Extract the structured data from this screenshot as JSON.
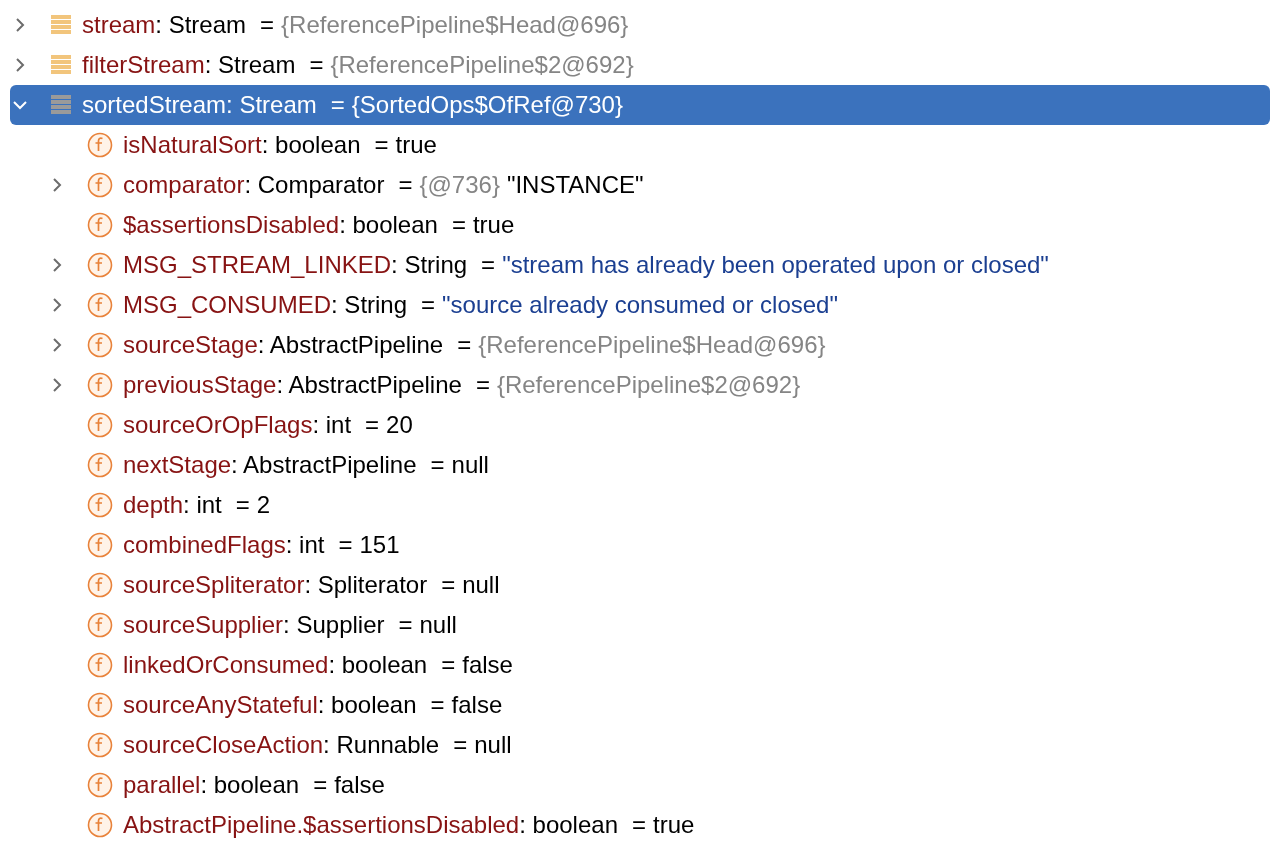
{
  "variables": [
    {
      "kind": "variable",
      "name": "stream",
      "type": ": Stream",
      "operator": "=",
      "value": {
        "kind": "ref",
        "text": "{ReferencePipeline$Head@696}"
      },
      "expanded": false,
      "selected": false
    },
    {
      "kind": "variable",
      "name": "filterStream",
      "type": ": Stream",
      "operator": "=",
      "value": {
        "kind": "ref",
        "text": "{ReferencePipeline$2@692}"
      },
      "expanded": false,
      "selected": false
    },
    {
      "kind": "variable",
      "name": "sortedStream",
      "type": ": Stream",
      "operator": "=",
      "value": {
        "kind": "ref",
        "text": "{SortedOps$OfRef@730}"
      },
      "expanded": true,
      "selected": true,
      "children": [
        {
          "kind": "field",
          "name": "isNaturalSort",
          "type": ": boolean",
          "operator": "=",
          "value": {
            "kind": "plain",
            "text": "true"
          },
          "selected": false
        },
        {
          "kind": "field",
          "name": "comparator",
          "type": ": Comparator",
          "operator": "=",
          "value": {
            "kind": "ref",
            "text": "{@736}"
          },
          "label": "\"INSTANCE\"",
          "expanded": false,
          "selected": false
        },
        {
          "kind": "field",
          "name": "$assertionsDisabled",
          "type": ": boolean",
          "operator": "=",
          "value": {
            "kind": "plain",
            "text": "true"
          },
          "selected": false
        },
        {
          "kind": "field",
          "name": "MSG_STREAM_LINKED",
          "type": ": String",
          "operator": "=",
          "value": {
            "kind": "string",
            "text": "\"stream has already been operated upon or closed\""
          },
          "expanded": false,
          "selected": false
        },
        {
          "kind": "field",
          "name": "MSG_CONSUMED",
          "type": ": String",
          "operator": "=",
          "value": {
            "kind": "string",
            "text": "\"source already consumed or closed\""
          },
          "expanded": false,
          "selected": false
        },
        {
          "kind": "field",
          "name": "sourceStage",
          "type": ": AbstractPipeline",
          "operator": "=",
          "value": {
            "kind": "ref",
            "text": "{ReferencePipeline$Head@696}"
          },
          "expanded": false,
          "selected": false
        },
        {
          "kind": "field",
          "name": "previousStage",
          "type": ": AbstractPipeline",
          "operator": "=",
          "value": {
            "kind": "ref",
            "text": "{ReferencePipeline$2@692}"
          },
          "expanded": false,
          "selected": false
        },
        {
          "kind": "field",
          "name": "sourceOrOpFlags",
          "type": ": int",
          "operator": "=",
          "value": {
            "kind": "plain",
            "text": "20"
          },
          "selected": false
        },
        {
          "kind": "field",
          "name": "nextStage",
          "type": ": AbstractPipeline",
          "operator": "=",
          "value": {
            "kind": "plain",
            "text": "null"
          },
          "selected": false
        },
        {
          "kind": "field",
          "name": "depth",
          "type": ": int",
          "operator": "=",
          "value": {
            "kind": "plain",
            "text": "2"
          },
          "selected": false
        },
        {
          "kind": "field",
          "name": "combinedFlags",
          "type": ": int",
          "operator": "=",
          "value": {
            "kind": "plain",
            "text": "151"
          },
          "selected": false
        },
        {
          "kind": "field",
          "name": "sourceSpliterator",
          "type": ": Spliterator",
          "operator": "=",
          "value": {
            "kind": "plain",
            "text": "null"
          },
          "selected": false
        },
        {
          "kind": "field",
          "name": "sourceSupplier",
          "type": ": Supplier",
          "operator": "=",
          "value": {
            "kind": "plain",
            "text": "null"
          },
          "selected": false
        },
        {
          "kind": "field",
          "name": "linkedOrConsumed",
          "type": ": boolean",
          "operator": "=",
          "value": {
            "kind": "plain",
            "text": "false"
          },
          "selected": false
        },
        {
          "kind": "field",
          "name": "sourceAnyStateful",
          "type": ": boolean",
          "operator": "=",
          "value": {
            "kind": "plain",
            "text": "false"
          },
          "selected": false
        },
        {
          "kind": "field",
          "name": "sourceCloseAction",
          "type": ": Runnable",
          "operator": "=",
          "value": {
            "kind": "plain",
            "text": "null"
          },
          "selected": false
        },
        {
          "kind": "field",
          "name": "parallel",
          "type": ": boolean",
          "operator": "=",
          "value": {
            "kind": "plain",
            "text": "false"
          },
          "selected": false
        },
        {
          "kind": "field",
          "name": "AbstractPipeline.$assertionsDisabled",
          "type": ": boolean",
          "operator": "=",
          "value": {
            "kind": "plain",
            "text": "true"
          },
          "selected": false
        }
      ]
    }
  ]
}
